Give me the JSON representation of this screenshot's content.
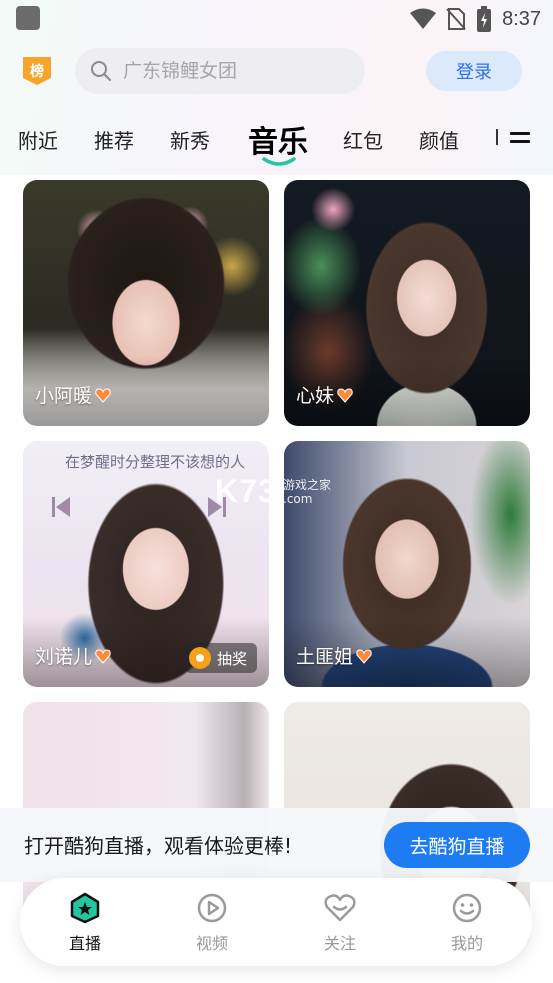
{
  "status_bar": {
    "time": "8:37"
  },
  "header": {
    "rank_badge_label": "榜",
    "search_placeholder": "广东锦鲤女团",
    "login_label": "登录"
  },
  "tabs": {
    "items": [
      "附近",
      "推荐",
      "新秀",
      "音乐",
      "红包",
      "颜值"
    ],
    "active": "音乐"
  },
  "cards": [
    {
      "name": "小阿暖"
    },
    {
      "name": "心妹"
    },
    {
      "name": "刘诺儿",
      "lyric": "在梦醒时分整理不该想的人",
      "badge": "抽奖"
    },
    {
      "name": "土匪姐"
    },
    {
      "name": ""
    },
    {
      "name": ""
    }
  ],
  "watermark": {
    "logo": "K73",
    "sub": "游戏之家",
    "domain": ".com"
  },
  "promo": {
    "text": "打开酷狗直播，观看体验更棒!",
    "button_label": "去酷狗直播"
  },
  "bottom_nav": [
    {
      "label": "直播",
      "icon": "live-icon"
    },
    {
      "label": "视频",
      "icon": "video-play-icon"
    },
    {
      "label": "关注",
      "icon": "heart-icon"
    },
    {
      "label": "我的",
      "icon": "smiley-icon"
    }
  ],
  "colors": {
    "accent_blue": "#1e7cf2",
    "active_tab_green": "#21c7a0",
    "login_bg": "#dce9fb"
  }
}
